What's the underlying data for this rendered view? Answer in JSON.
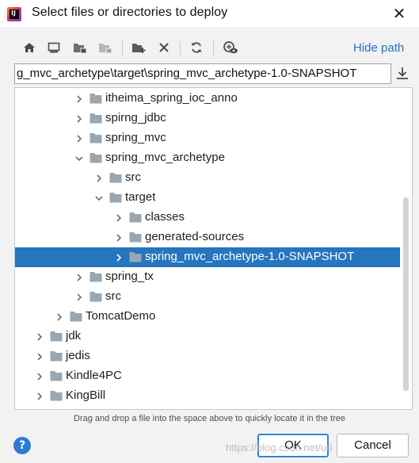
{
  "window": {
    "title": "Select files or directories to deploy",
    "app_icon_letters": "IJ",
    "close_glyph": "✕"
  },
  "toolbar": {
    "buttons": [
      {
        "name": "home-icon"
      },
      {
        "name": "desktop-icon"
      },
      {
        "name": "project-folder-icon"
      },
      {
        "name": "module-folder-icon"
      },
      {
        "name": "new-folder-icon"
      },
      {
        "name": "delete-icon"
      },
      {
        "name": "refresh-icon"
      },
      {
        "name": "show-hidden-icon"
      }
    ],
    "hide_path_label": "Hide path"
  },
  "path_field": {
    "value": "g_mvc_archetype\\target\\spring_mvc_archetype-1.0-SNAPSHOT"
  },
  "tree": {
    "rows": [
      {
        "label": "itheima_spring_ioc_anno",
        "expanded": false,
        "selected": false
      },
      {
        "label": "spirng_jdbc",
        "expanded": false,
        "selected": false
      },
      {
        "label": "spring_mvc",
        "expanded": false,
        "selected": false
      },
      {
        "label": "spring_mvc_archetype",
        "expanded": true,
        "selected": false
      },
      {
        "label": "src",
        "expanded": false,
        "selected": false
      },
      {
        "label": "target",
        "expanded": true,
        "selected": false
      },
      {
        "label": "classes",
        "expanded": false,
        "selected": false
      },
      {
        "label": "generated-sources",
        "expanded": false,
        "selected": false
      },
      {
        "label": "spring_mvc_archetype-1.0-SNAPSHOT",
        "expanded": false,
        "selected": true
      },
      {
        "label": "spring_tx",
        "expanded": false,
        "selected": false
      },
      {
        "label": "src",
        "expanded": false,
        "selected": false
      },
      {
        "label": "TomcatDemo",
        "expanded": false,
        "selected": false
      },
      {
        "label": "jdk",
        "expanded": false,
        "selected": false
      },
      {
        "label": "jedis",
        "expanded": false,
        "selected": false
      },
      {
        "label": "Kindle4PC",
        "expanded": false,
        "selected": false
      },
      {
        "label": "KingBill",
        "expanded": false,
        "selected": false
      }
    ]
  },
  "hint": "Drag and drop a file into the space above to quickly locate it in the tree",
  "buttons": {
    "help": "?",
    "ok": "OK",
    "cancel": "Cancel"
  },
  "watermark": "https://blog.csdn.net/u0",
  "colors": {
    "selection": "#2675bf",
    "link": "#2470c8",
    "folder": "#9aa7b0",
    "primary_button_border": "#2e86de"
  }
}
